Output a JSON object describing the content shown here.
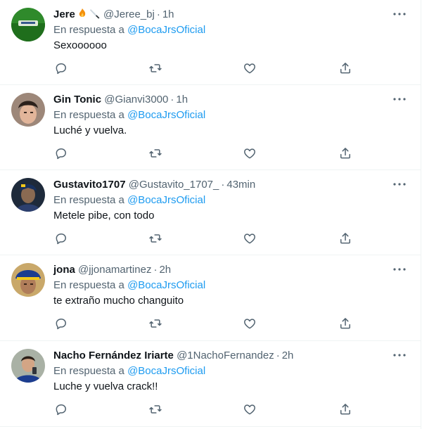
{
  "reply_prefix": "En respuesta a",
  "dot": "·",
  "tweets": [
    {
      "name": "Jere",
      "name_emoji": [
        "flame",
        "knife"
      ],
      "handle": "@Jeree_bj",
      "time": "1h",
      "reply_to": "@BocaJrsOficial",
      "text": "Sexoooooo"
    },
    {
      "name": "Gin Tonic",
      "handle": "@Gianvi3000",
      "time": "1h",
      "reply_to": "@BocaJrsOficial",
      "text": "Luché y vuelva."
    },
    {
      "name": "Gustavito1707",
      "handle": "@Gustavito_1707_",
      "time": "43min",
      "reply_to": "@BocaJrsOficial",
      "text": "Metele pibe, con todo"
    },
    {
      "name": "jona",
      "handle": "@jjonamartinez",
      "time": "2h",
      "reply_to": "@BocaJrsOficial",
      "text": "te extraño mucho changuito"
    },
    {
      "name": "Nacho Fernández Iriarte",
      "handle": "@1NachoFernandez",
      "time": "2h",
      "reply_to": "@BocaJrsOficial",
      "text": "Luche y vuelva crack!!"
    }
  ],
  "icons": {
    "reply": "reply-icon",
    "retweet": "retweet-icon",
    "like": "heart-icon",
    "share": "share-icon",
    "more": "more-icon"
  },
  "colors": {
    "link": "#1d9bf0",
    "secondary_text": "#536471",
    "primary_text": "#0f1419",
    "divider": "#eff3f4"
  }
}
